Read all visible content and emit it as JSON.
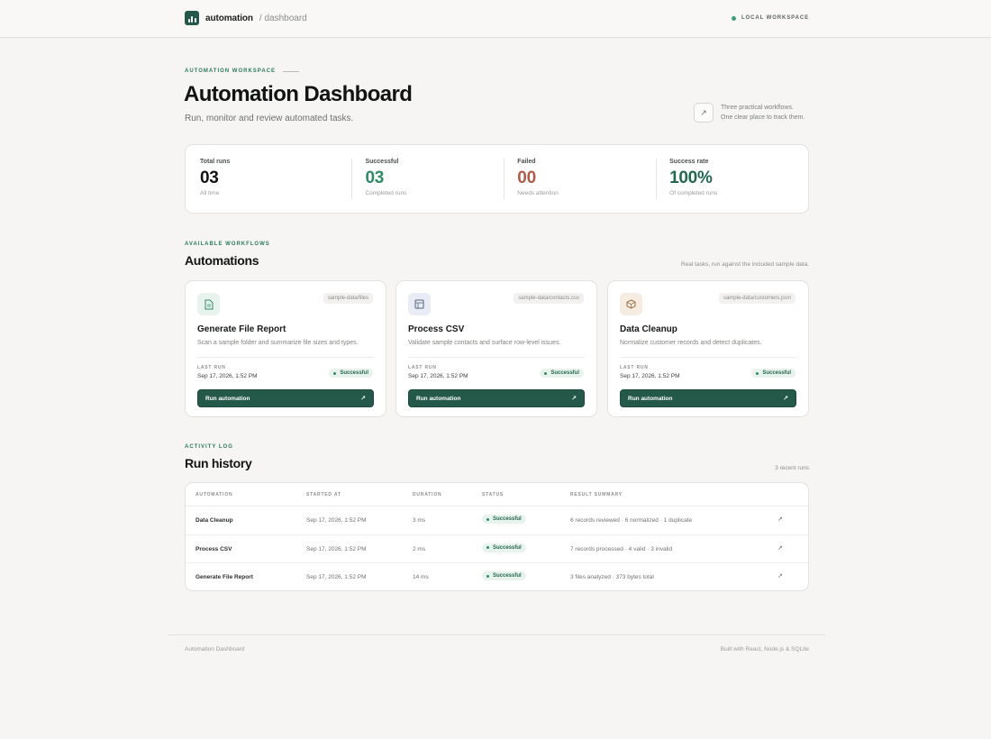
{
  "topbar": {
    "brand": "automation",
    "brand_sub": "/ dashboard",
    "workspace": "LOCAL WORKSPACE"
  },
  "hero": {
    "eyebrow": "AUTOMATION WORKSPACE",
    "title": "Automation Dashboard",
    "subtitle": "Run, monitor and review automated tasks.",
    "note_line1": "Three practical workflows.",
    "note_line2": "One clear place to track them."
  },
  "stats": [
    {
      "label": "Total runs",
      "value": "03",
      "hint": "All time",
      "color": "#111413"
    },
    {
      "label": "Successful",
      "value": "03",
      "hint": "Completed runs",
      "color": "#2f8a66"
    },
    {
      "label": "Failed",
      "value": "00",
      "hint": "Needs attention",
      "color": "#b05a4a"
    },
    {
      "label": "Success rate",
      "value": "100%",
      "hint": "Of completed runs",
      "color": "#24674f"
    }
  ],
  "workflows": {
    "eyebrow": "AVAILABLE WORKFLOWS",
    "title": "Automations",
    "note": "Real tasks, run against the included sample data.",
    "cards": [
      {
        "title": "Generate File Report",
        "desc": "Scan a sample folder and summarize file sizes and types.",
        "path": "sample-data/files",
        "last_run_label": "LAST RUN",
        "last_run": "Sep 17, 2026, 1:52 PM",
        "status": "Successful",
        "button": "Run automation",
        "icon": "file-icon",
        "icon_bg": "#e8f3ed",
        "icon_color": "#2f8a66"
      },
      {
        "title": "Process CSV",
        "desc": "Validate sample contacts and surface row-level issues.",
        "path": "sample-data/contacts.csv",
        "last_run_label": "LAST RUN",
        "last_run": "Sep 17, 2026, 1:52 PM",
        "status": "Successful",
        "button": "Run automation",
        "icon": "table-icon",
        "icon_bg": "#e9ecf5",
        "icon_color": "#52617f"
      },
      {
        "title": "Data Cleanup",
        "desc": "Normalize customer records and detect duplicates.",
        "path": "sample-data/customers.json",
        "last_run_label": "LAST RUN",
        "last_run": "Sep 17, 2026, 1:52 PM",
        "status": "Successful",
        "button": "Run automation",
        "icon": "box-icon",
        "icon_bg": "#f6ece1",
        "icon_color": "#9a6b3f"
      }
    ]
  },
  "history": {
    "eyebrow": "ACTIVITY LOG",
    "title": "Run history",
    "note": "3 recent runs",
    "columns": [
      "AUTOMATION",
      "STARTED AT",
      "DURATION",
      "STATUS",
      "RESULT SUMMARY"
    ],
    "rows": [
      {
        "automation": "Data Cleanup",
        "started": "Sep 17, 2026, 1:52 PM",
        "duration": "3 ms",
        "status": "Successful",
        "summary": "6 records reviewed · 6 normalized · 1 duplicate"
      },
      {
        "automation": "Process CSV",
        "started": "Sep 17, 2026, 1:52 PM",
        "duration": "2 ms",
        "status": "Successful",
        "summary": "7 records processed · 4 valid · 3 invalid"
      },
      {
        "automation": "Generate File Report",
        "started": "Sep 17, 2026, 1:52 PM",
        "duration": "14 ms",
        "status": "Successful",
        "summary": "3 files analyzed · 373 bytes total"
      }
    ]
  },
  "footer": {
    "left": "Automation Dashboard",
    "right": "Built with React, Node.js & SQLite"
  },
  "colors": {
    "accent": "#24594a",
    "success": "#2f8a66",
    "danger": "#b05a4a",
    "background": "#f6f5f4"
  }
}
